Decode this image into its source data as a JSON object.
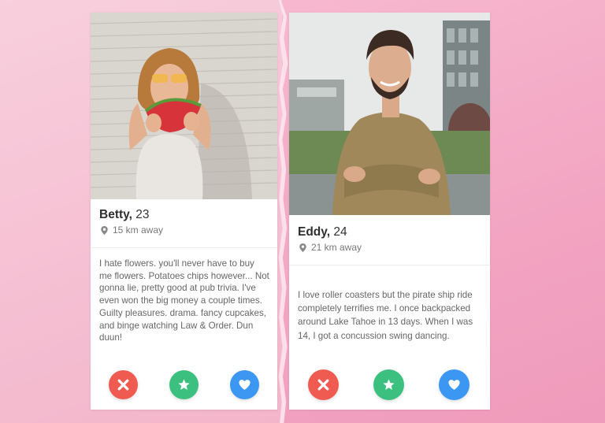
{
  "profiles": [
    {
      "name": "Betty,",
      "age": "23",
      "distance": "15 km away",
      "bio": "I hate flowers. you'll never have to buy me flowers. Potatoes chips however... Not gonna lie, pretty good at pub trivia. I've even won the big money a couple times.\nGuilty pleasures. drama. fancy cupcakes, and binge watching Law & Order. Dun duun!",
      "photo_icon": "profile-photo-woman-eating-watermelon"
    },
    {
      "name": "Eddy,",
      "age": "24",
      "distance": "21 km away",
      "bio": "I love roller coasters but the pirate ship ride completely terrifies me. I once backpacked around Lake Tahoe in 13 days. When I was 14, I got a concussion swing dancing.",
      "photo_icon": "profile-photo-man-arms-crossed"
    }
  ],
  "actions": {
    "dislike_icon": "x-icon",
    "superlike_icon": "star-icon",
    "like_icon": "heart-icon"
  },
  "colors": {
    "dislike": "#ef5b50",
    "superlike": "#3cc07f",
    "like": "#3c97f3",
    "background_left": "#f5bfd2",
    "background_right": "#f2a4c1"
  }
}
